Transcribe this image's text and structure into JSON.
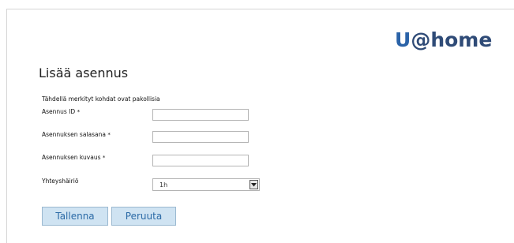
{
  "logo": {
    "u": "U",
    "rest": "@home"
  },
  "page": {
    "title": "Lisää asennus",
    "required_note": "Tähdellä merkityt kohdat ovat pakollisia"
  },
  "form": {
    "fields": [
      {
        "label": "Asennus ID",
        "required_marker": "*",
        "value": ""
      },
      {
        "label": "Asennuksen salasana",
        "required_marker": "*",
        "value": ""
      },
      {
        "label": "Asennuksen kuvaus",
        "required_marker": "*",
        "value": ""
      }
    ],
    "connection_fault": {
      "label": "Yhteyshäiriö",
      "selected": "1h"
    }
  },
  "buttons": {
    "save": "Tallenna",
    "cancel": "Peruuta"
  },
  "colors": {
    "logo_u": "#2b63a8",
    "logo_text": "#2f4b77",
    "button_bg": "#cfe3f2",
    "button_text": "#2b6aa6"
  }
}
